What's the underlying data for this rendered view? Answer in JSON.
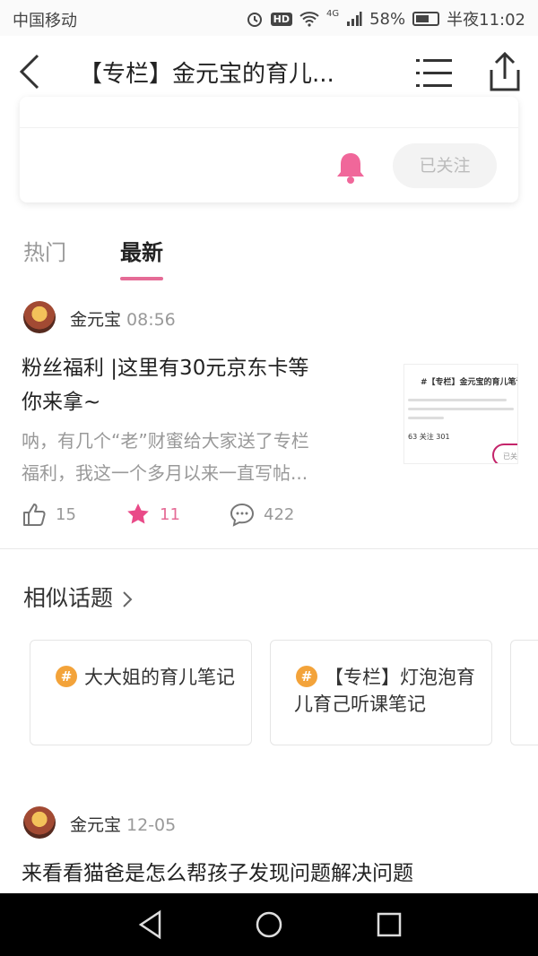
{
  "status_bar": {
    "carrier": "中国移动",
    "network": "4G",
    "hd": "HD",
    "battery": "58%",
    "time": "半夜11:02"
  },
  "nav": {
    "title": "【专栏】金元宝的育儿..."
  },
  "card": {
    "follow_label": "已关注"
  },
  "tabs": [
    {
      "label": "热门"
    },
    {
      "label": "最新"
    }
  ],
  "posts": [
    {
      "author": "金元宝",
      "time": "08:56",
      "title_line1": "粉丝福利 |这里有30元京东卡等",
      "title_line2": "你来拿~",
      "snippet_line1": "呐，有几个“老”财蜜给大家送了专栏",
      "snippet_line2": "福利，我这一个多月以来一直写帖...",
      "thumb": {
        "title": "#【专栏】金元宝的育儿笔记",
        "stat": "63 关注 301",
        "btn": "已关注"
      },
      "likes": "15",
      "favorites": "11",
      "comments": "422"
    },
    {
      "author": "金元宝",
      "time": "12-05",
      "title_line1": "来看看猫爸是怎么帮孩子发现问题解决问题"
    }
  ],
  "similar": {
    "title": "相似话题",
    "topics": [
      {
        "label": "大大姐的育儿笔记"
      },
      {
        "label": "【专栏】灯泡泡育儿育己听课笔记"
      }
    ]
  },
  "colors": {
    "accent": "#e56b96",
    "topic_icon": "#f3a33a"
  }
}
